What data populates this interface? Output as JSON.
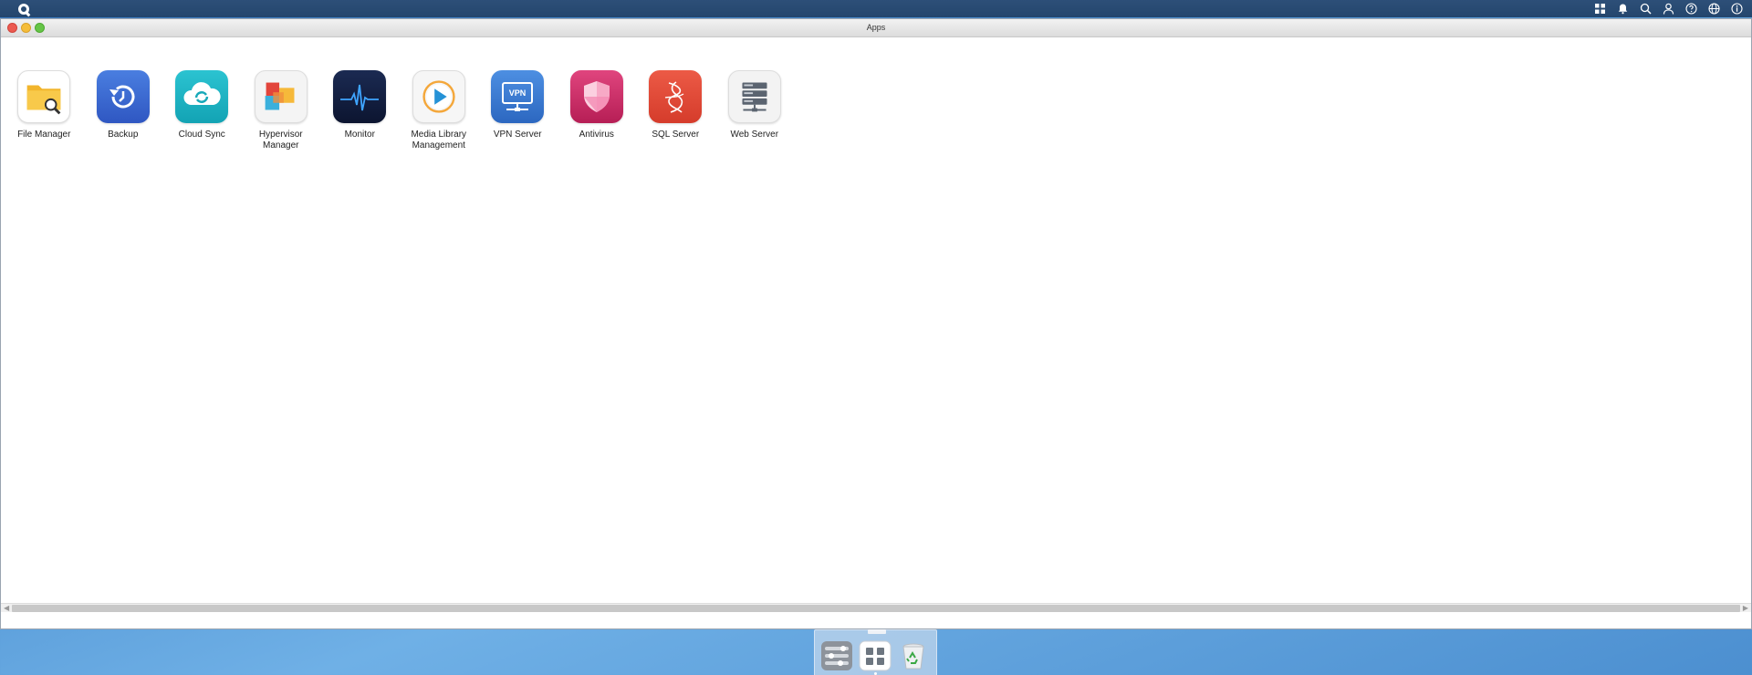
{
  "window": {
    "title": "Apps"
  },
  "apps": [
    {
      "label": "File Manager",
      "icon": "file-manager-icon"
    },
    {
      "label": "Backup",
      "icon": "backup-icon"
    },
    {
      "label": "Cloud Sync",
      "icon": "cloud-sync-icon"
    },
    {
      "label": "Hypervisor Manager",
      "icon": "hypervisor-icon"
    },
    {
      "label": "Monitor",
      "icon": "monitor-icon"
    },
    {
      "label": "Media Library Management",
      "icon": "media-library-icon"
    },
    {
      "label": "VPN Server",
      "icon": "vpn-server-icon",
      "badge": "VPN"
    },
    {
      "label": "Antivirus",
      "icon": "antivirus-icon"
    },
    {
      "label": "SQL Server",
      "icon": "sql-server-icon"
    },
    {
      "label": "Web Server",
      "icon": "web-server-icon"
    }
  ],
  "topbar_icons": [
    "apps-grid-icon",
    "bell-icon",
    "search-icon",
    "user-icon",
    "help-icon",
    "globe-icon",
    "info-icon"
  ],
  "dock": [
    "control-panel-icon",
    "apps-launcher-icon",
    "recycle-bin-icon"
  ],
  "colors": {
    "topbar": "#24466d",
    "desktop": "#4f93d3",
    "close": "#ec5a50",
    "minimize": "#f5bd3a",
    "maximize": "#66c547"
  }
}
